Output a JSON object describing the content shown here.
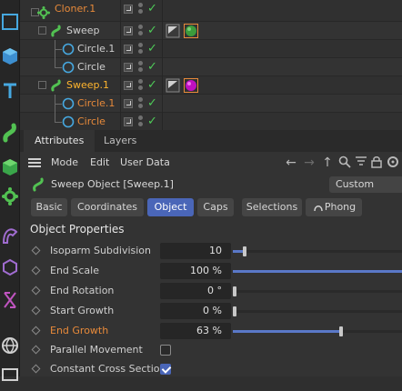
{
  "object_manager": {
    "rows": [
      {
        "name": "Cloner.1",
        "icon": "cloner-icon"
      },
      {
        "name": "Sweep",
        "icon": "sweep-icon"
      },
      {
        "name": "Circle.1",
        "icon": "circle-spline-icon"
      },
      {
        "name": "Circle",
        "icon": "circle-spline-icon"
      },
      {
        "name": "Sweep.1",
        "icon": "sweep-icon"
      },
      {
        "name": "Circle.1",
        "icon": "circle-spline-icon"
      },
      {
        "name": "Circle",
        "icon": "circle-spline-icon"
      }
    ]
  },
  "attributes": {
    "tabs": [
      "Attributes",
      "Layers"
    ],
    "menu": [
      "Mode",
      "Edit",
      "User Data"
    ],
    "object_title": "Sweep Object [Sweep.1]",
    "mode_dropdown": "Custom",
    "subtabs": [
      "Basic",
      "Coordinates",
      "Object",
      "Caps",
      "Selections",
      "Phong"
    ],
    "active_subtab": "Object",
    "section_title": "Object Properties",
    "properties": [
      {
        "label": "Isoparm Subdivision",
        "value": "10",
        "slider_fraction": 0.06
      },
      {
        "label": "End Scale",
        "value": "100 %",
        "slider_fraction": 1.0
      },
      {
        "label": "End Rotation",
        "value": "0 °",
        "slider_fraction": 0.0
      },
      {
        "label": "Start Growth",
        "value": "0 %",
        "slider_fraction": 0.0
      },
      {
        "label": "End Growth",
        "value": "63 %",
        "slider_fraction": 0.63
      },
      {
        "label": "Parallel Movement",
        "checked": false
      },
      {
        "label": "Constant Cross Section",
        "checked": true
      }
    ]
  },
  "colors": {
    "accent": "#4a66b8",
    "selected_name": "#ffb52e",
    "modified_param": "#e88a3a",
    "check_green": "#4ecb58"
  }
}
